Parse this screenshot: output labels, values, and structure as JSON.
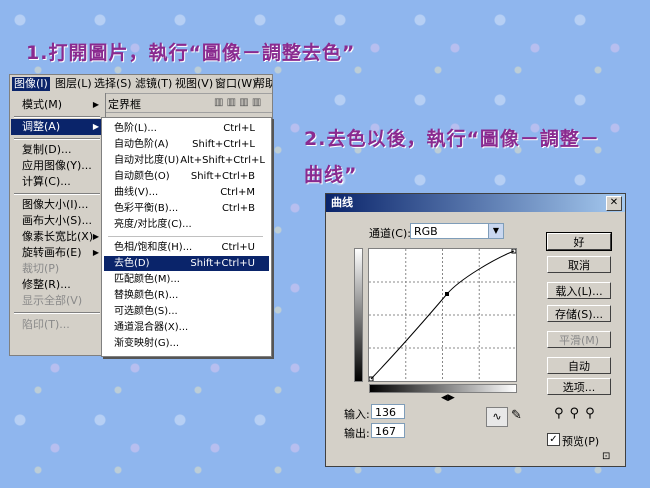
{
  "titles": {
    "step1": "1.打開圖片，執行“圖像－調整去色”",
    "step2_line1": "2.去色以後，執行“圖像－調整－",
    "step2_line2": "曲线”"
  },
  "ps_menubar": [
    "图像(I)",
    "图层(L)",
    "选择(S)",
    "滤镜(T)",
    "视图(V)",
    "窗口(W)",
    "帮助"
  ],
  "ps_toolbar_text": "定界框",
  "image_menu": [
    {
      "label": "模式(M)",
      "arrow": true
    },
    {
      "label": "调整(A)",
      "arrow": true,
      "selected": true
    },
    {
      "label": "复制(D)..."
    },
    {
      "label": "应用图像(Y)..."
    },
    {
      "label": "计算(C)..."
    },
    {
      "label": "图像大小(I)..."
    },
    {
      "label": "画布大小(S)..."
    },
    {
      "label": "像素长宽比(X)",
      "arrow": true
    },
    {
      "label": "旋转画布(E)",
      "arrow": true
    },
    {
      "label": "裁切(P)",
      "disabled": true
    },
    {
      "label": "修整(R)..."
    },
    {
      "label": "显示全部(V)",
      "disabled": true
    },
    {
      "label": "陷印(T)...",
      "disabled": true
    }
  ],
  "adjust_menu": [
    {
      "label": "色阶(L)...",
      "shortcut": "Ctrl+L"
    },
    {
      "label": "自动色阶(A)",
      "shortcut": "Shift+Ctrl+L"
    },
    {
      "label": "自动对比度(U)",
      "shortcut": "Alt+Shift+Ctrl+L"
    },
    {
      "label": "自动颜色(O)",
      "shortcut": "Shift+Ctrl+B"
    },
    {
      "label": "曲线(V)...",
      "shortcut": "Ctrl+M"
    },
    {
      "label": "色彩平衡(B)...",
      "shortcut": "Ctrl+B"
    },
    {
      "label": "亮度/对比度(C)...",
      "shortcut": ""
    },
    {
      "label": "色相/饱和度(H)...",
      "shortcut": "Ctrl+U"
    },
    {
      "label": "去色(D)",
      "shortcut": "Shift+Ctrl+U",
      "selected": true
    },
    {
      "label": "匹配颜色(M)...",
      "shortcut": ""
    },
    {
      "label": "替换颜色(R)...",
      "shortcut": ""
    },
    {
      "label": "可选颜色(S)...",
      "shortcut": ""
    },
    {
      "label": "通道混合器(X)...",
      "shortcut": ""
    },
    {
      "label": "渐变映射(G)...",
      "shortcut": ""
    }
  ],
  "curves_dialog": {
    "title": "曲线",
    "close": "✕",
    "channel_label": "通道(C):",
    "channel_value": "RGB",
    "buttons": {
      "ok": "好",
      "cancel": "取消",
      "load": "载入(L)...",
      "save": "存储(S)...",
      "smooth": "平滑(M)",
      "auto": "自动",
      "options": "选项..."
    },
    "input_label": "输入:",
    "input_value": "136",
    "output_label": "输出:",
    "output_value": "167",
    "preview_label": "预览(P)",
    "preview_checked": true
  }
}
